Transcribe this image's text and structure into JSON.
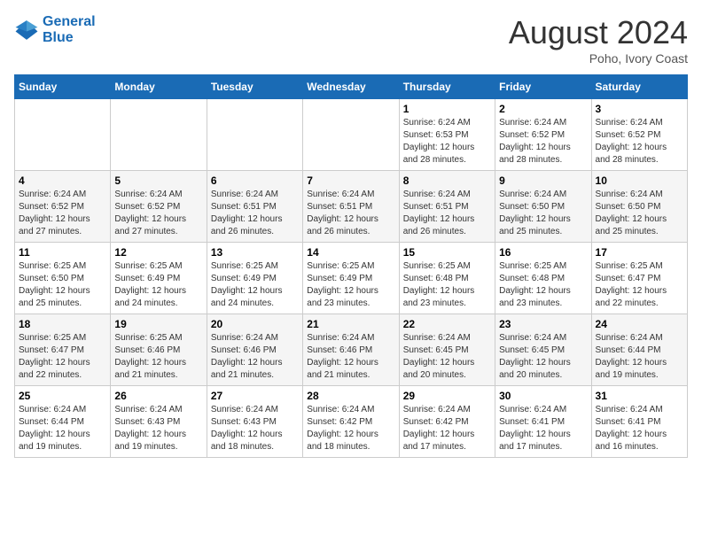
{
  "header": {
    "logo_line1": "General",
    "logo_line2": "Blue",
    "title": "August 2024",
    "subtitle": "Poho, Ivory Coast"
  },
  "days_of_week": [
    "Sunday",
    "Monday",
    "Tuesday",
    "Wednesday",
    "Thursday",
    "Friday",
    "Saturday"
  ],
  "weeks": [
    [
      {
        "day": "",
        "info": ""
      },
      {
        "day": "",
        "info": ""
      },
      {
        "day": "",
        "info": ""
      },
      {
        "day": "",
        "info": ""
      },
      {
        "day": "1",
        "info": "Sunrise: 6:24 AM\nSunset: 6:53 PM\nDaylight: 12 hours\nand 28 minutes."
      },
      {
        "day": "2",
        "info": "Sunrise: 6:24 AM\nSunset: 6:52 PM\nDaylight: 12 hours\nand 28 minutes."
      },
      {
        "day": "3",
        "info": "Sunrise: 6:24 AM\nSunset: 6:52 PM\nDaylight: 12 hours\nand 28 minutes."
      }
    ],
    [
      {
        "day": "4",
        "info": "Sunrise: 6:24 AM\nSunset: 6:52 PM\nDaylight: 12 hours\nand 27 minutes."
      },
      {
        "day": "5",
        "info": "Sunrise: 6:24 AM\nSunset: 6:52 PM\nDaylight: 12 hours\nand 27 minutes."
      },
      {
        "day": "6",
        "info": "Sunrise: 6:24 AM\nSunset: 6:51 PM\nDaylight: 12 hours\nand 26 minutes."
      },
      {
        "day": "7",
        "info": "Sunrise: 6:24 AM\nSunset: 6:51 PM\nDaylight: 12 hours\nand 26 minutes."
      },
      {
        "day": "8",
        "info": "Sunrise: 6:24 AM\nSunset: 6:51 PM\nDaylight: 12 hours\nand 26 minutes."
      },
      {
        "day": "9",
        "info": "Sunrise: 6:24 AM\nSunset: 6:50 PM\nDaylight: 12 hours\nand 25 minutes."
      },
      {
        "day": "10",
        "info": "Sunrise: 6:24 AM\nSunset: 6:50 PM\nDaylight: 12 hours\nand 25 minutes."
      }
    ],
    [
      {
        "day": "11",
        "info": "Sunrise: 6:25 AM\nSunset: 6:50 PM\nDaylight: 12 hours\nand 25 minutes."
      },
      {
        "day": "12",
        "info": "Sunrise: 6:25 AM\nSunset: 6:49 PM\nDaylight: 12 hours\nand 24 minutes."
      },
      {
        "day": "13",
        "info": "Sunrise: 6:25 AM\nSunset: 6:49 PM\nDaylight: 12 hours\nand 24 minutes."
      },
      {
        "day": "14",
        "info": "Sunrise: 6:25 AM\nSunset: 6:49 PM\nDaylight: 12 hours\nand 23 minutes."
      },
      {
        "day": "15",
        "info": "Sunrise: 6:25 AM\nSunset: 6:48 PM\nDaylight: 12 hours\nand 23 minutes."
      },
      {
        "day": "16",
        "info": "Sunrise: 6:25 AM\nSunset: 6:48 PM\nDaylight: 12 hours\nand 23 minutes."
      },
      {
        "day": "17",
        "info": "Sunrise: 6:25 AM\nSunset: 6:47 PM\nDaylight: 12 hours\nand 22 minutes."
      }
    ],
    [
      {
        "day": "18",
        "info": "Sunrise: 6:25 AM\nSunset: 6:47 PM\nDaylight: 12 hours\nand 22 minutes."
      },
      {
        "day": "19",
        "info": "Sunrise: 6:25 AM\nSunset: 6:46 PM\nDaylight: 12 hours\nand 21 minutes."
      },
      {
        "day": "20",
        "info": "Sunrise: 6:24 AM\nSunset: 6:46 PM\nDaylight: 12 hours\nand 21 minutes."
      },
      {
        "day": "21",
        "info": "Sunrise: 6:24 AM\nSunset: 6:46 PM\nDaylight: 12 hours\nand 21 minutes."
      },
      {
        "day": "22",
        "info": "Sunrise: 6:24 AM\nSunset: 6:45 PM\nDaylight: 12 hours\nand 20 minutes."
      },
      {
        "day": "23",
        "info": "Sunrise: 6:24 AM\nSunset: 6:45 PM\nDaylight: 12 hours\nand 20 minutes."
      },
      {
        "day": "24",
        "info": "Sunrise: 6:24 AM\nSunset: 6:44 PM\nDaylight: 12 hours\nand 19 minutes."
      }
    ],
    [
      {
        "day": "25",
        "info": "Sunrise: 6:24 AM\nSunset: 6:44 PM\nDaylight: 12 hours\nand 19 minutes."
      },
      {
        "day": "26",
        "info": "Sunrise: 6:24 AM\nSunset: 6:43 PM\nDaylight: 12 hours\nand 19 minutes."
      },
      {
        "day": "27",
        "info": "Sunrise: 6:24 AM\nSunset: 6:43 PM\nDaylight: 12 hours\nand 18 minutes."
      },
      {
        "day": "28",
        "info": "Sunrise: 6:24 AM\nSunset: 6:42 PM\nDaylight: 12 hours\nand 18 minutes."
      },
      {
        "day": "29",
        "info": "Sunrise: 6:24 AM\nSunset: 6:42 PM\nDaylight: 12 hours\nand 17 minutes."
      },
      {
        "day": "30",
        "info": "Sunrise: 6:24 AM\nSunset: 6:41 PM\nDaylight: 12 hours\nand 17 minutes."
      },
      {
        "day": "31",
        "info": "Sunrise: 6:24 AM\nSunset: 6:41 PM\nDaylight: 12 hours\nand 16 minutes."
      }
    ]
  ]
}
